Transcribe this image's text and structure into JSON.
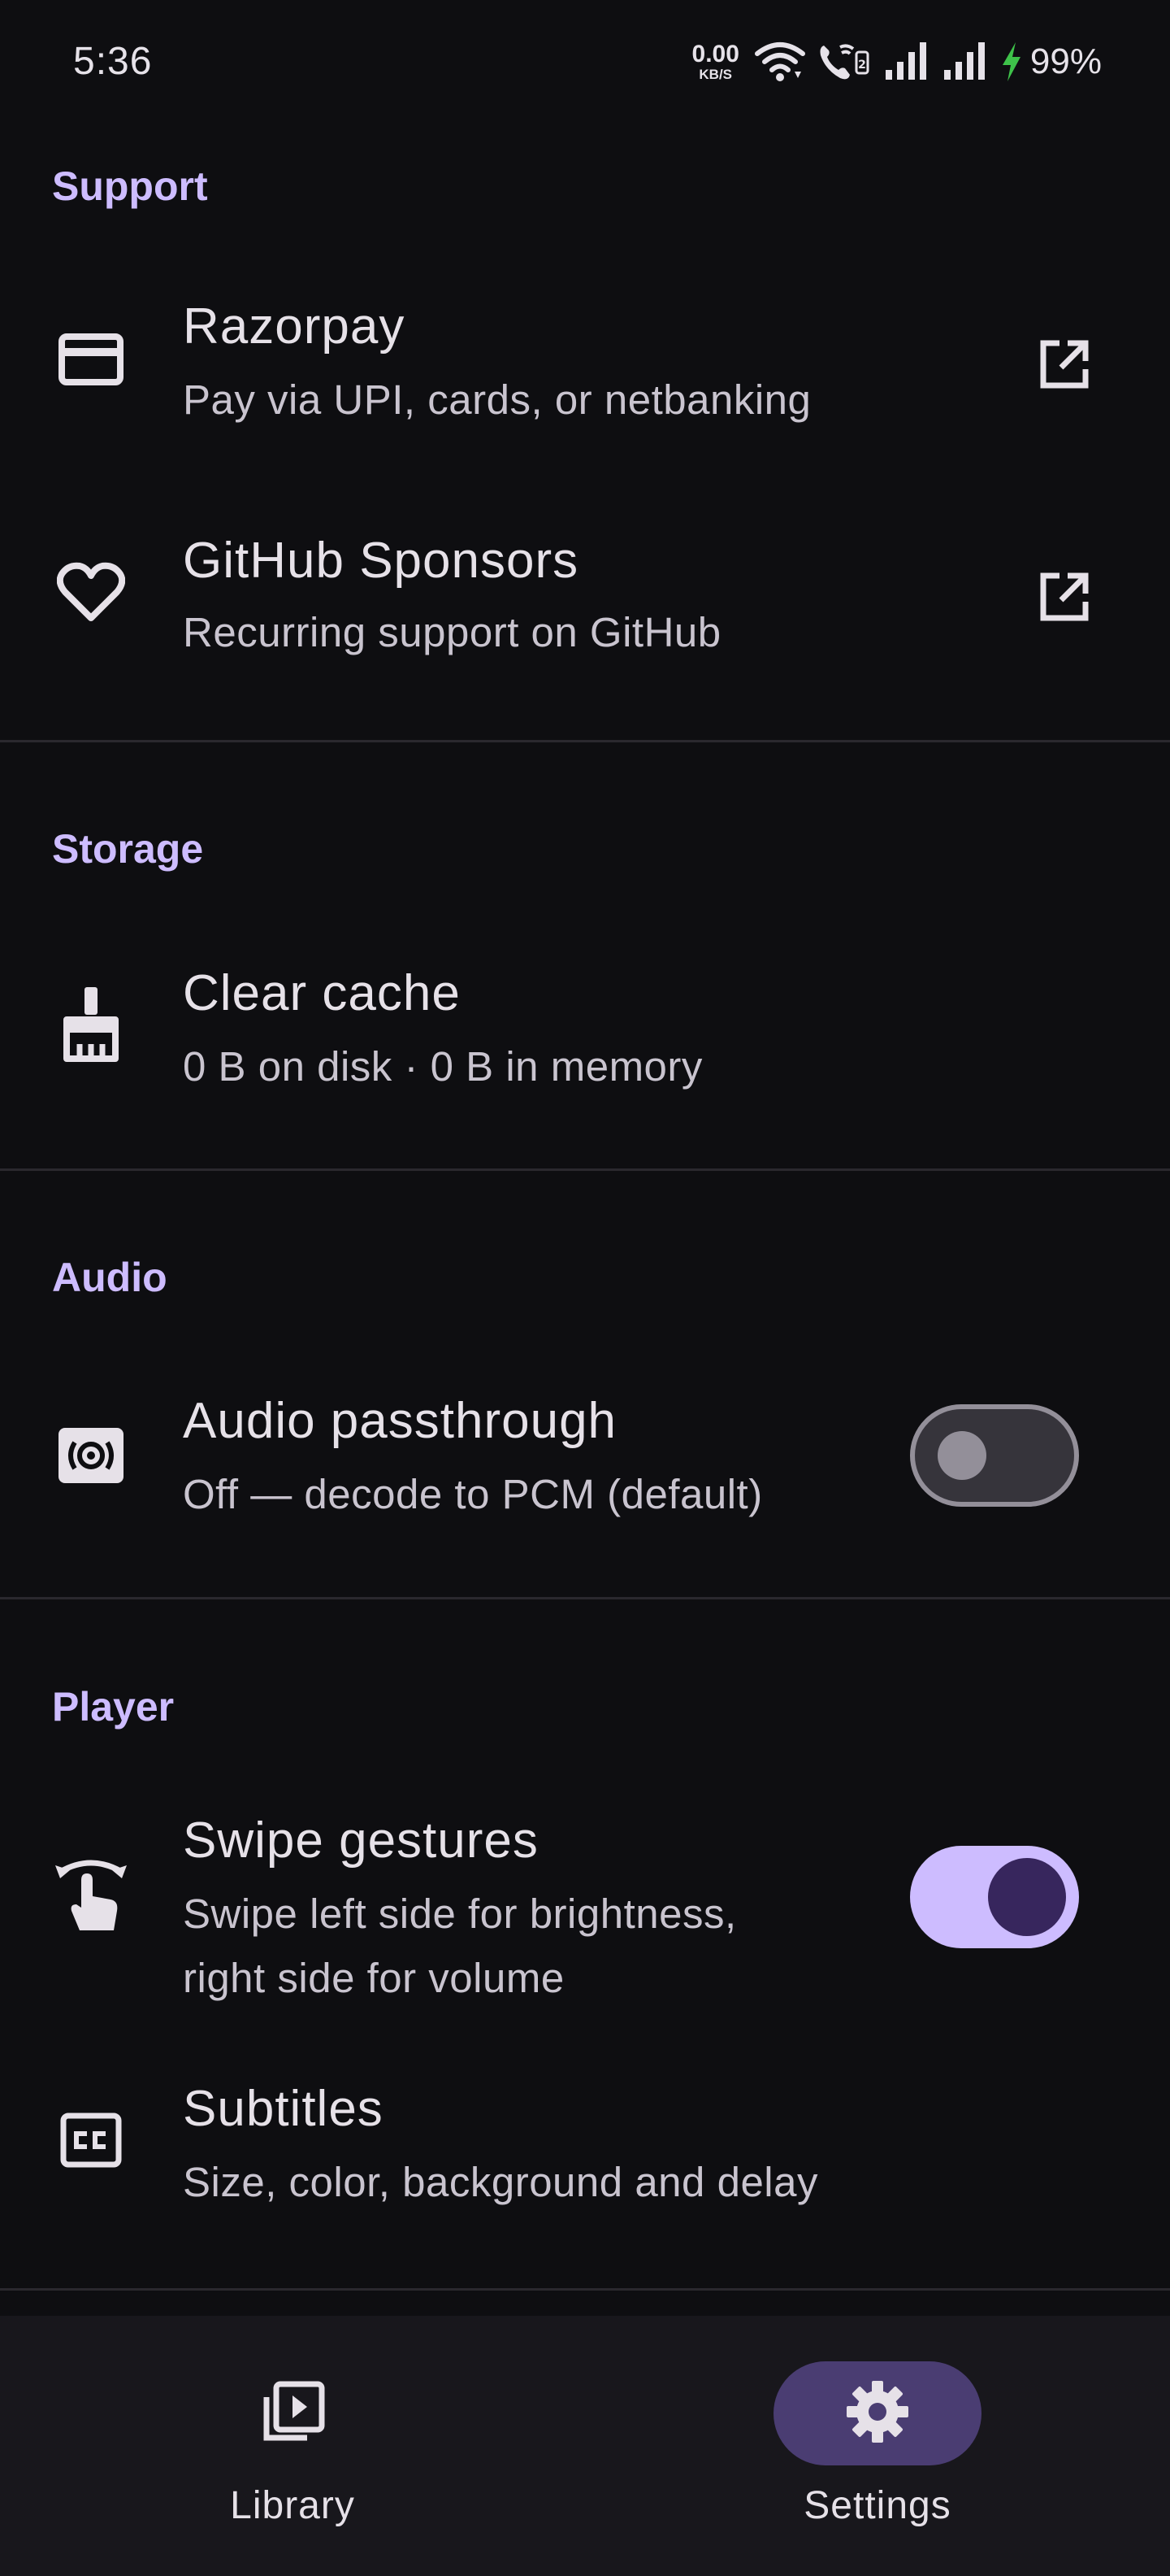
{
  "status_bar": {
    "time": "5:36",
    "net_speed_value": "0.00",
    "net_speed_unit": "KB/S",
    "battery": "99%",
    "icons": [
      "wifi-icon",
      "wifi-calling-icon",
      "signal-icon",
      "signal-icon",
      "charging-icon"
    ]
  },
  "sections": {
    "support": {
      "header": "Support",
      "razorpay": {
        "title": "Razorpay",
        "subtitle": "Pay via UPI, cards, or netbanking",
        "icon": "credit-card-icon",
        "trailing_icon": "open-external-icon"
      },
      "github": {
        "title": "GitHub Sponsors",
        "subtitle": "Recurring support on GitHub",
        "icon": "heart-icon",
        "trailing_icon": "open-external-icon"
      }
    },
    "storage": {
      "header": "Storage",
      "clear_cache": {
        "title": "Clear cache",
        "subtitle": "0 B on disk · 0 B in memory",
        "icon": "broom-icon"
      }
    },
    "audio": {
      "header": "Audio",
      "passthrough": {
        "title": "Audio passthrough",
        "subtitle": "Off — decode to PCM (default)",
        "icon": "surround-sound-icon",
        "enabled": false
      }
    },
    "player": {
      "header": "Player",
      "swipe": {
        "title": "Swipe gestures",
        "subtitle_line1": "Swipe left side for brightness,",
        "subtitle_line2": "right side for volume",
        "icon": "swipe-gesture-icon",
        "enabled": true
      },
      "subtitles": {
        "title": "Subtitles",
        "subtitle": "Size, color, background and delay",
        "icon": "closed-caption-icon"
      }
    }
  },
  "bottom_nav": {
    "items": [
      {
        "label": "Library",
        "icon": "video-library-icon",
        "active": false
      },
      {
        "label": "Settings",
        "icon": "gear-icon",
        "active": true
      }
    ]
  },
  "colors": {
    "background": "#0e0e11",
    "accent": "#cdbcff",
    "nav_background": "#18171c",
    "active_pill": "#4a3d72",
    "charging": "#3ec24a"
  }
}
